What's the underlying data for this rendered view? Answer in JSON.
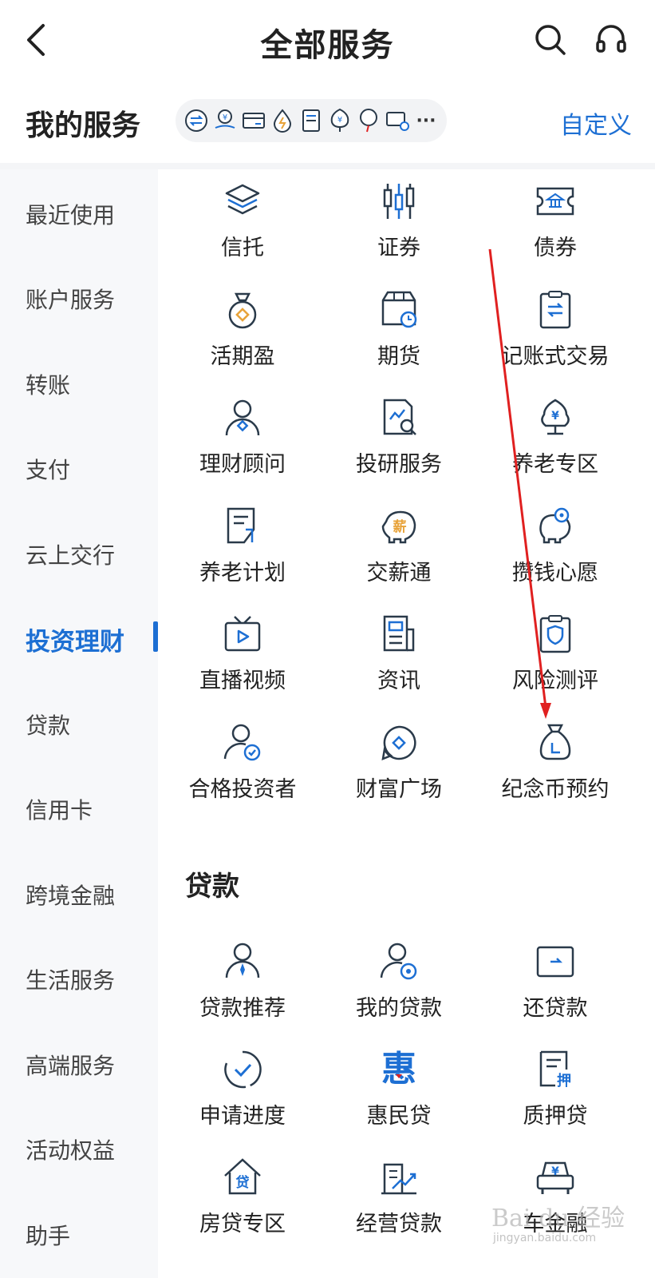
{
  "header": {
    "title": "全部服务",
    "back_icon": "chevron-left-icon",
    "search_icon": "search-icon",
    "service_icon": "headset-icon"
  },
  "my_services": {
    "title": "我的服务",
    "customize": "自定义",
    "more": "···",
    "icons": [
      "transfer-icon",
      "wealth-hand-icon",
      "card-icon",
      "water-bill-icon",
      "document-icon",
      "pension-tree-icon",
      "balloon-icon",
      "card-link-icon"
    ]
  },
  "sidebar": {
    "items": [
      {
        "label": "最近使用"
      },
      {
        "label": "账户服务"
      },
      {
        "label": "转账"
      },
      {
        "label": "支付"
      },
      {
        "label": "云上交行"
      },
      {
        "label": "投资理财",
        "active": true
      },
      {
        "label": "贷款"
      },
      {
        "label": "信用卡"
      },
      {
        "label": "跨境金融"
      },
      {
        "label": "生活服务"
      },
      {
        "label": "高端服务"
      },
      {
        "label": "活动权益"
      },
      {
        "label": "助手"
      }
    ]
  },
  "investment": {
    "items": [
      {
        "label": "信托",
        "icon": "layers-icon"
      },
      {
        "label": "证券",
        "icon": "candlestick-icon"
      },
      {
        "label": "债券",
        "icon": "bond-ticket-icon"
      },
      {
        "label": "活期盈",
        "icon": "money-bag-icon"
      },
      {
        "label": "期货",
        "icon": "box-clock-icon"
      },
      {
        "label": "记账式交易",
        "icon": "clipboard-exchange-icon"
      },
      {
        "label": "理财顾问",
        "icon": "advisor-icon"
      },
      {
        "label": "投研服务",
        "icon": "research-doc-icon"
      },
      {
        "label": "养老专区",
        "icon": "pension-tree-icon"
      },
      {
        "label": "养老计划",
        "icon": "plan-doc-icon"
      },
      {
        "label": "交薪通",
        "icon": "salary-piggy-icon",
        "badge": "薪"
      },
      {
        "label": "攒钱心愿",
        "icon": "piggy-bank-icon"
      },
      {
        "label": "直播视频",
        "icon": "tv-play-icon"
      },
      {
        "label": "资讯",
        "icon": "news-icon"
      },
      {
        "label": "风险测评",
        "icon": "shield-clipboard-icon"
      },
      {
        "label": "合格投资者",
        "icon": "user-check-icon"
      },
      {
        "label": "财富广场",
        "icon": "wealth-chat-icon"
      },
      {
        "label": "纪念币预约",
        "icon": "coin-bag-clock-icon"
      }
    ]
  },
  "loans": {
    "title": "贷款",
    "items": [
      {
        "label": "贷款推荐",
        "icon": "recommend-user-icon"
      },
      {
        "label": "我的贷款",
        "icon": "user-loan-icon"
      },
      {
        "label": "还贷款",
        "icon": "repay-card-icon"
      },
      {
        "label": "申请进度",
        "icon": "progress-check-icon"
      },
      {
        "label": "惠民贷",
        "icon": "huimin-icon",
        "badge": "惠"
      },
      {
        "label": "质押贷",
        "icon": "pledge-doc-icon",
        "badge": "押"
      },
      {
        "label": "房贷专区",
        "icon": "house-loan-icon",
        "badge": "贷"
      },
      {
        "label": "经营贷款",
        "icon": "business-chart-icon"
      },
      {
        "label": "车金融",
        "icon": "car-finance-icon",
        "badge": "¥"
      }
    ]
  },
  "colors": {
    "accent": "#1d6fd3",
    "icon_dark": "#2a3a4a",
    "icon_orange": "#e8a33a",
    "annotation_red": "#e02020"
  },
  "watermark": {
    "text": "Bai du 经验",
    "sub": "jingyan.baidu.com"
  }
}
